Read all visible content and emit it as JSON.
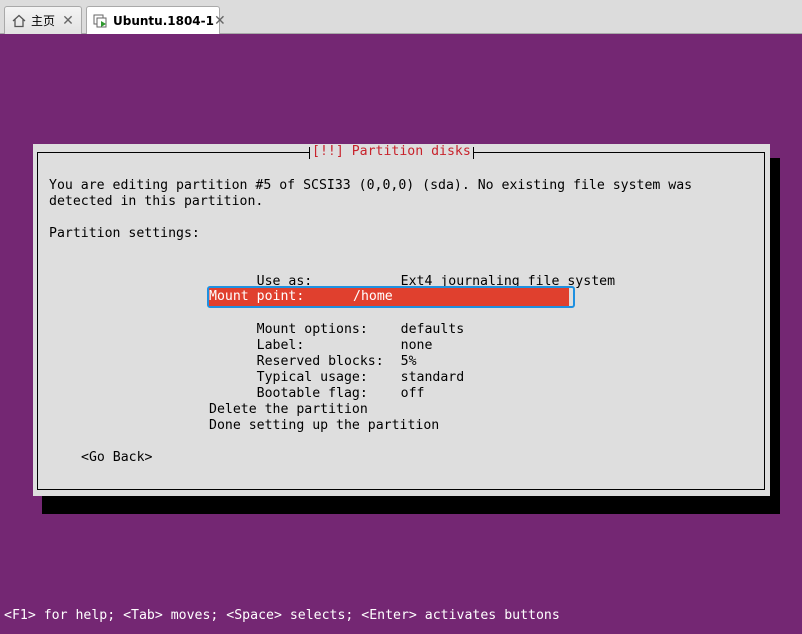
{
  "tabs": [
    {
      "label": "主页",
      "icon": "home-icon"
    },
    {
      "label": "Ubuntu.1804-1",
      "icon": "vm-icon",
      "active": true
    }
  ],
  "installer": {
    "background_color": "#742773",
    "dialog_title": "[!!] Partition disks",
    "intro_line1": "You are editing partition #5 of SCSI33 (0,0,0) (sda). No existing file system was",
    "intro_line2": "detected in this partition.",
    "section_label": "Partition settings:",
    "use_as": {
      "key": "Use as:",
      "value": "Ext4 journaling file system"
    },
    "settings": [
      {
        "key": "Mount point:",
        "value": "/home",
        "selected": true
      },
      {
        "key": "Mount options:",
        "value": "defaults"
      },
      {
        "key": "Label:",
        "value": "none"
      },
      {
        "key": "Reserved blocks:",
        "value": "5%"
      },
      {
        "key": "Typical usage:",
        "value": "standard"
      },
      {
        "key": "Bootable flag:",
        "value": "off"
      }
    ],
    "actions": [
      "Delete the partition",
      "Done setting up the partition"
    ],
    "back_button": "<Go Back>",
    "help_line": "<F1> for help; <Tab> moves; <Space> selects; <Enter> activates buttons"
  }
}
